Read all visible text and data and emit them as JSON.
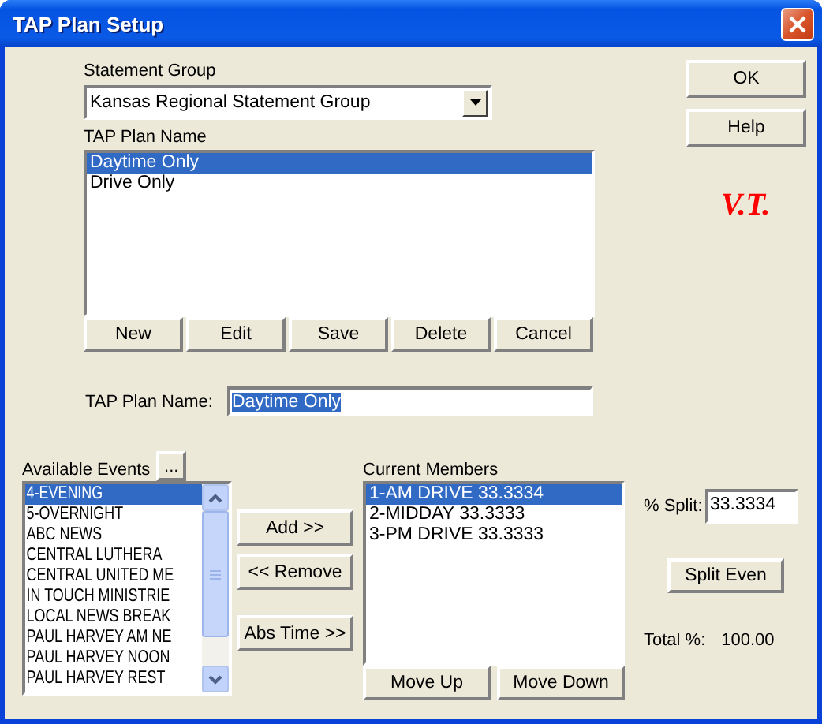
{
  "window": {
    "title": "TAP Plan Setup"
  },
  "statement_group": {
    "label": "Statement Group",
    "value": "Kansas Regional Statement Group"
  },
  "plan_list": {
    "label": "TAP Plan Name",
    "items": [
      {
        "text": "Daytime Only",
        "selected": true
      },
      {
        "text": "Drive Only",
        "selected": false
      }
    ]
  },
  "plan_buttons": [
    {
      "label": "New"
    },
    {
      "label": "Edit"
    },
    {
      "label": "Save"
    },
    {
      "label": "Delete"
    },
    {
      "label": "Cancel"
    }
  ],
  "side_buttons": [
    {
      "label": "OK"
    },
    {
      "label": "Help"
    }
  ],
  "initials": "V.T.",
  "plan_name_field": {
    "label": "TAP Plan Name:",
    "value": "Daytime Only",
    "text_selected": true
  },
  "available_events": {
    "label": "Available Events",
    "browse_button": "...",
    "items": [
      {
        "text": "4-EVENING",
        "selected": true
      },
      {
        "text": "5-OVERNIGHT",
        "selected": false
      },
      {
        "text": "ABC NEWS",
        "selected": false
      },
      {
        "text": "CENTRAL LUTHERA",
        "selected": false
      },
      {
        "text": "CENTRAL UNITED ME",
        "selected": false
      },
      {
        "text": "IN TOUCH MINISTRIE",
        "selected": false
      },
      {
        "text": "LOCAL NEWS BREAK",
        "selected": false
      },
      {
        "text": "PAUL HARVEY AM NE",
        "selected": false
      },
      {
        "text": "PAUL HARVEY NOON",
        "selected": false
      },
      {
        "text": "PAUL HARVEY REST",
        "selected": false
      }
    ]
  },
  "transfer_buttons": [
    {
      "label": "Add >>"
    },
    {
      "label": "<< Remove"
    },
    {
      "label": "Abs Time >>"
    }
  ],
  "current_members": {
    "label": "Current Members",
    "items": [
      {
        "text": "1-AM DRIVE 33.3334",
        "selected": true
      },
      {
        "text": "2-MIDDAY 33.3333",
        "selected": false
      },
      {
        "text": "3-PM DRIVE 33.3333",
        "selected": false
      }
    ],
    "buttons": [
      {
        "label": "Move Up"
      },
      {
        "label": "Move Down"
      }
    ]
  },
  "split": {
    "label": "% Split:",
    "value": "33.3334",
    "button": {
      "label": "Split Even"
    },
    "total_label": "Total %:",
    "total_value": "100.00"
  }
}
